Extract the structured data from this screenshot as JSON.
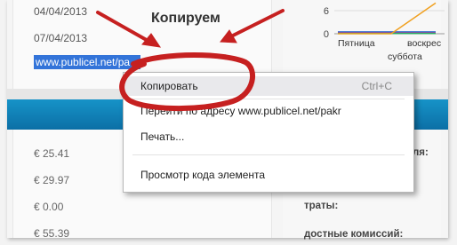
{
  "annotation": {
    "heading": "Копируем"
  },
  "left_panel": {
    "dates": [
      "04/04/2013",
      "07/04/2013"
    ],
    "selected_url": "www.publicel.net/pa",
    "amounts": [
      "€ 25.41",
      "€ 29.97",
      "€ 0.00",
      "€ 55.39"
    ]
  },
  "chart_data": {
    "type": "line",
    "y_ticks": [
      "6",
      "0"
    ],
    "categories": [
      "Пятница",
      "суббота",
      "воскрес"
    ],
    "series": [
      {
        "values": [
          0.5,
          0.5,
          0.5
        ]
      },
      {
        "values": [
          0.3,
          0.3,
          0.3
        ]
      },
      {
        "values": [
          0.1,
          0.1,
          0.1
        ]
      },
      {
        "values": [
          0,
          0,
          8
        ]
      }
    ]
  },
  "right_panel": {
    "labels": [
      "ля:",
      "траты:",
      "достные комиссий:"
    ]
  },
  "context_menu": {
    "items": [
      {
        "label": "Копировать",
        "shortcut": "Ctrl+C"
      },
      {
        "label": "Перейти по адресу www.publicel.net/pakr",
        "shortcut": ""
      },
      {
        "label": "Печать...",
        "shortcut": ""
      },
      {
        "label": "Просмотр кода элемента",
        "shortcut": ""
      }
    ]
  },
  "colors": {
    "selection": "#3374d9",
    "band": "#1693c8",
    "annotation": "#c62020"
  }
}
